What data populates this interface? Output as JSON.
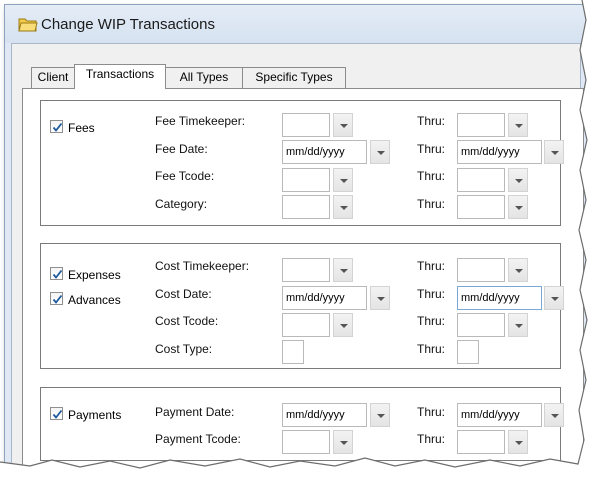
{
  "window": {
    "title": "Change WIP Transactions"
  },
  "tabs": [
    {
      "label": "Client"
    },
    {
      "label": "Transactions"
    },
    {
      "label": "All Types"
    },
    {
      "label": "Specific Types"
    }
  ],
  "fees": {
    "checkbox_label": "Fees",
    "checked": true,
    "timekeeper_label": "Fee Timekeeper:",
    "date_label": "Fee Date:",
    "tcode_label": "Fee Tcode:",
    "category_label": "Category:",
    "thru_label": "Thru:",
    "date_from": "mm/dd/yyyy",
    "date_thru": "mm/dd/yyyy"
  },
  "costs": {
    "expenses_label": "Expenses",
    "expenses_checked": true,
    "advances_label": "Advances",
    "advances_checked": true,
    "timekeeper_label": "Cost Timekeeper:",
    "date_label": "Cost Date:",
    "tcode_label": "Cost Tcode:",
    "type_label": "Cost Type:",
    "thru_label": "Thru:",
    "date_from": "mm/dd/yyyy",
    "date_thru": "mm/dd/yyyy"
  },
  "payments": {
    "checkbox_label": "Payments",
    "checked": true,
    "date_label": "Payment Date:",
    "tcode_label": "Payment Tcode:",
    "thru_label": "Thru:",
    "date_from": "mm/dd/yyyy",
    "date_thru": "mm/dd/yyyy"
  },
  "icons": {
    "title_icon": "folder-icon",
    "checkbox_mark": "checkmark-icon",
    "dropdown": "chevron-down-icon"
  },
  "colors": {
    "titlebar": "#dfe8f4",
    "window_border": "#8da2bd",
    "folder": "#f2cc4a"
  }
}
